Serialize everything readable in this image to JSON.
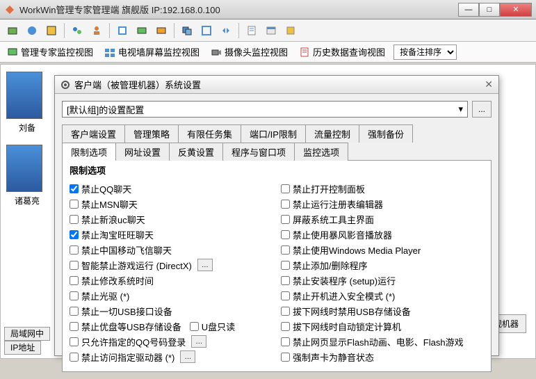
{
  "titlebar": {
    "text": "WorkWin管理专家管理端    旗舰版 IP:192.168.0.100"
  },
  "viewbar": {
    "v1": "管理专家监控视图",
    "v2": "电视墙屏幕监控视图",
    "v3": "摄像头监控视图",
    "v4": "历史数据查询视图",
    "sortbox": "按备注排序"
  },
  "thumbs": {
    "n1": "刘备",
    "n2": "诸葛亮"
  },
  "bottomtabs": {
    "t1": "局域网中",
    "t2": "IP地址"
  },
  "rightbtn": "监视机器",
  "dialog": {
    "title": "客户端（被管理机器）系统设置",
    "config_label": "[默认组]的设置配置",
    "dotbtn": "...",
    "tabs_row1": [
      "客户端设置",
      "管理策略",
      "有限任务集",
      "端口/IP限制",
      "流量控制",
      "强制备份"
    ],
    "tabs_row2": [
      "限制选项",
      "网址设置",
      "反黄设置",
      "程序与窗口项",
      "监控选项"
    ],
    "group_title": "限制选项",
    "udisk_readonly": "U盘只读",
    "left": [
      {
        "label": "禁止QQ聊天",
        "checked": true
      },
      {
        "label": "禁止MSN聊天",
        "checked": false
      },
      {
        "label": "禁止新浪uc聊天",
        "checked": false
      },
      {
        "label": "禁止淘宝旺旺聊天",
        "checked": true
      },
      {
        "label": "禁止中国移动飞信聊天",
        "checked": false
      },
      {
        "label": "智能禁止游戏运行 (DirectX)",
        "checked": false,
        "ellipsis": true
      },
      {
        "label": "禁止修改系统时间",
        "checked": false
      },
      {
        "label": "禁止光驱 (*)",
        "checked": false
      },
      {
        "label": "禁止一切USB接口设备",
        "checked": false
      },
      {
        "label": "禁止优盘等USB存储设备",
        "checked": false,
        "udisk": true
      },
      {
        "label": "只允许指定的QQ号码登录",
        "checked": false,
        "ellipsis": true
      },
      {
        "label": "禁止访问指定驱动器 (*)",
        "checked": false,
        "ellipsis": true
      }
    ],
    "right": [
      {
        "label": "禁止打开控制面板",
        "checked": false
      },
      {
        "label": "禁止运行注册表编辑器",
        "checked": false
      },
      {
        "label": "屏蔽系统工具主界面",
        "checked": false
      },
      {
        "label": "禁止使用暴风影音播放器",
        "checked": false
      },
      {
        "label": "禁止使用Windows Media Player",
        "checked": false
      },
      {
        "label": "禁止添加/删除程序",
        "checked": false
      },
      {
        "label": "禁止安装程序 (setup)运行",
        "checked": false
      },
      {
        "label": "禁止开机进入安全模式 (*)",
        "checked": false
      },
      {
        "label": "拔下网线时禁用USB存储设备",
        "checked": false
      },
      {
        "label": "拔下网线时自动锁定计算机",
        "checked": false
      },
      {
        "label": "禁止网页显示Flash动画、电影、Flash游戏",
        "checked": false
      },
      {
        "label": "强制声卡为静音状态",
        "checked": false
      }
    ]
  }
}
